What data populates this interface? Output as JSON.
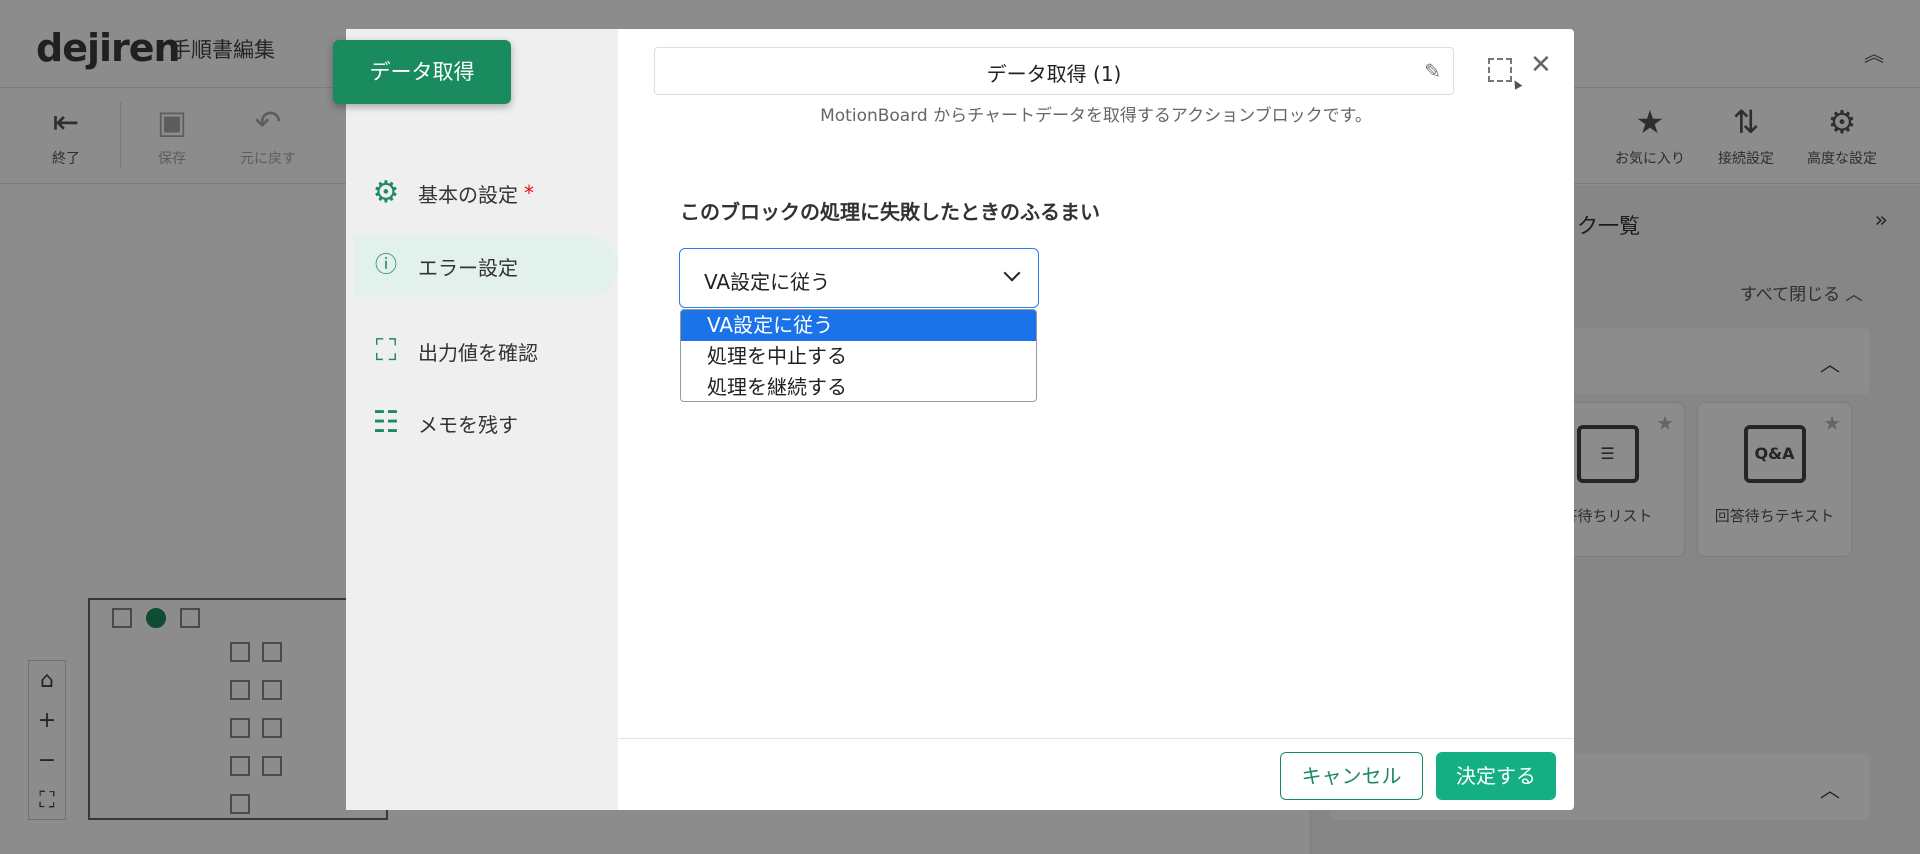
{
  "app": {
    "logo": "dejiren",
    "page_name": "手順書編集"
  },
  "toolbar": {
    "items": [
      {
        "label": "終了",
        "icon": "exit-icon"
      },
      {
        "label": "保存",
        "icon": "save-icon"
      },
      {
        "label": "元に戻す",
        "icon": "undo-icon"
      },
      {
        "label": "お気に入り",
        "icon": "star-icon"
      },
      {
        "label": "接続設定",
        "icon": "connection-icon"
      },
      {
        "label": "高度な設定",
        "icon": "gears-icon"
      }
    ]
  },
  "right_panel": {
    "title": "ック一覧",
    "close_all": "すべて閉じる",
    "cards": [
      {
        "label": "答待ちリスト",
        "icon": "checklist-icon"
      },
      {
        "label": "回答待ちテキスト",
        "icon": "qa-icon",
        "icon_text": "Q&A"
      }
    ]
  },
  "dialog": {
    "block_tag": "データ取得",
    "title": "データ取得 (1)",
    "description": "MotionBoard からチャートデータを取得するアクションブロックです。",
    "nav": [
      {
        "label": "基本の設定",
        "required_mark": "*",
        "icon": "gear-icon"
      },
      {
        "label": "エラー設定",
        "icon": "error-icon",
        "active": true
      },
      {
        "label": "出力値を確認",
        "icon": "frame-icon"
      },
      {
        "label": "メモを残す",
        "icon": "memo-icon"
      }
    ],
    "section_label": "このブロックの処理に失敗したときのふるまい",
    "select": {
      "value": "VA設定に従う",
      "options": [
        "VA設定に従う",
        "処理を中止する",
        "処理を継続する"
      ]
    },
    "buttons": {
      "cancel": "キャンセル",
      "ok": "決定する"
    }
  },
  "colors": {
    "brand_green": "#1a8a5f",
    "primary_button": "#14b083",
    "selected_option": "#1a73e8"
  }
}
